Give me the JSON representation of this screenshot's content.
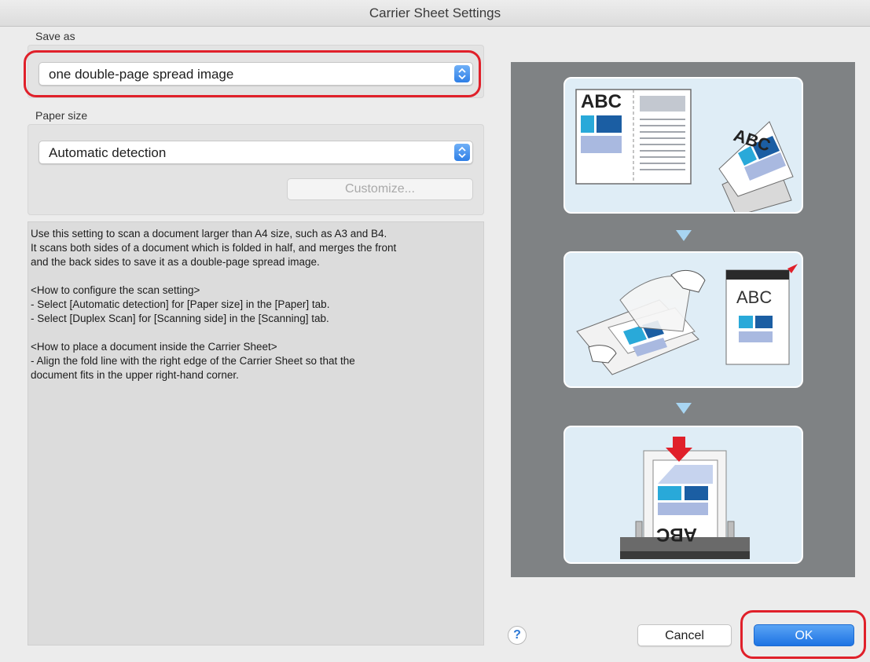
{
  "window": {
    "title": "Carrier Sheet Settings"
  },
  "save_as": {
    "label": "Save as",
    "value": "one double-page spread image"
  },
  "paper_size": {
    "label": "Paper size",
    "value": "Automatic detection",
    "customize_label": "Customize..."
  },
  "description": {
    "lines": [
      "Use this setting to scan a document larger than A4 size, such as A3 and B4.",
      "It scans both sides of a document which is folded in half, and merges the front",
      "and the back sides to save it as a double-page spread image.",
      "",
      "<How to configure the scan setting>",
      "- Select [Automatic detection] for [Paper size] in the [Paper] tab.",
      "- Select [Duplex Scan] for [Scanning side] in the [Scanning] tab.",
      "",
      "<How to place a document inside the Carrier Sheet>",
      "- Align the fold line with the right edge of the Carrier Sheet so that the",
      "document fits in the upper right-hand corner."
    ]
  },
  "illustration": {
    "card1": {
      "open_book_text": "ABC",
      "folded_text": "ABC"
    },
    "card2": {
      "sheet_text": "ABC"
    },
    "card3": {
      "reversed_text": "ABC"
    }
  },
  "buttons": {
    "help": "?",
    "cancel": "Cancel",
    "ok": "OK"
  },
  "colors": {
    "highlight": "#e0202a",
    "accent": "#2f7fe6",
    "illustration_bg": "#7f8284",
    "card_bg": "#dfedf6"
  }
}
